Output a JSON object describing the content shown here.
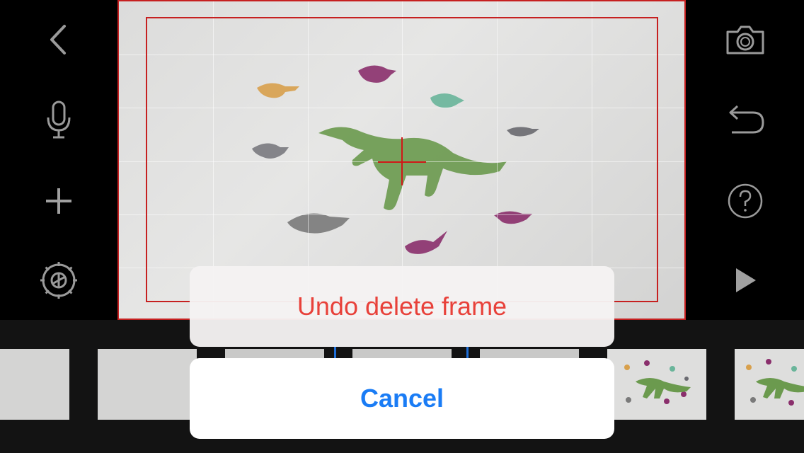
{
  "toolbar_left": {
    "back_icon": "chevron-left-icon",
    "mic_icon": "microphone-icon",
    "add_icon": "plus-icon",
    "settings_icon": "gear-icon"
  },
  "toolbar_right": {
    "camera_icon": "camera-icon",
    "undo_icon": "undo-arrow-icon",
    "help_icon": "question-mark-icon",
    "play_icon": "play-icon"
  },
  "colors": {
    "frame_border": "#c62020",
    "destructive_text": "#e8413a",
    "cancel_text": "#1a7cf5",
    "playhead": "#1e6fd9"
  },
  "action_sheet": {
    "action_label": "Undo delete frame",
    "cancel_label": "Cancel"
  }
}
